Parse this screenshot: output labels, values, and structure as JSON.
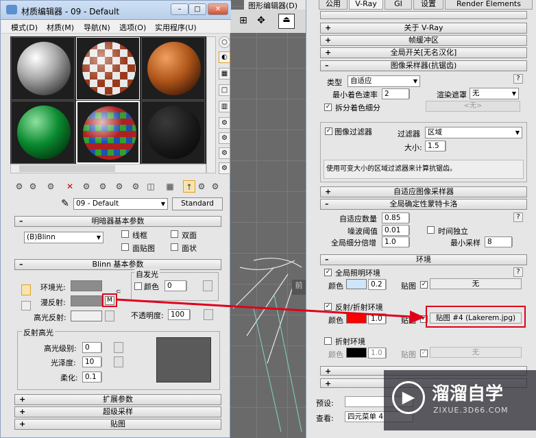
{
  "viewport_title": "图形编辑器(D)",
  "material_editor": {
    "title": "材质编辑器 - 09 - Default",
    "menu": [
      "模式(D)",
      "材质(M)",
      "导航(N)",
      "选项(O)",
      "实用程序(U)"
    ],
    "material_name": "09 - Default",
    "material_type": "Standard",
    "shader_rollout": "明暗器基本参数",
    "shader": "(B)Blinn",
    "shader_opts": [
      "线框",
      "双面",
      "面贴图",
      "面状"
    ],
    "blinn_rollout": "Blinn 基本参数",
    "self_illum": "自发光",
    "color_label": "颜色",
    "color_value": "0",
    "ambient": "环境光:",
    "diffuse": "漫反射:",
    "specular": "高光反射:",
    "diffuse_map_btn": "M",
    "opacity_label": "不透明度:",
    "opacity_value": "100",
    "spec_group": "反射高光",
    "spec_level_label": "高光级别:",
    "spec_level": "0",
    "gloss_label": "光泽度:",
    "gloss": "10",
    "soften_label": "柔化:",
    "soften": "0.1",
    "rollouts_bottom": [
      "扩展参数",
      "超级采样",
      "贴图"
    ]
  },
  "render_setup": {
    "tabs": [
      "公用",
      "V-Ray",
      "GI",
      "设置",
      "Render Elements"
    ],
    "rollouts": [
      "关于 V-Ray",
      "帧缓冲区",
      "全局开关[无名汉化]",
      "图像采样器(抗锯齿)"
    ],
    "type_label": "类型",
    "type_value": "自适应",
    "min_shading_label": "最小着色速率",
    "min_shading": "2",
    "render_mask_label": "渲染遮罩",
    "render_mask": "无",
    "none_btn": "<无>",
    "divide_shading": "拆分着色细分",
    "image_filter": "图像过滤器",
    "filter_label": "过滤器",
    "filter_value": "区域",
    "size_label": "大小:",
    "size_value": "1.5",
    "filter_desc": "使用可变大小的区域过滤器来计算抗锯齿。",
    "adaptive_rollout": "自适应图像采样器",
    "dmc_rollout": "全局确定性蒙特卡洛",
    "adaptive_amount_label": "自适应数量",
    "adaptive_amount": "0.85",
    "noise_label": "噪波阈值",
    "noise": "0.01",
    "time_indep": "时间独立",
    "subdiv_mult_label": "全局细分倍增",
    "subdiv_mult": "1.0",
    "min_samples_label": "最小采样",
    "min_samples": "8",
    "env_rollout": "环境",
    "gi_env": "全局照明环境",
    "color": "颜色",
    "gi_mult": "0.2",
    "map_label": "贴图",
    "none": "无",
    "refl_env": "反射/折射环境",
    "refl_mult": "1.0",
    "refl_map": "贴图 #4 (Lakerem.jpg)",
    "refr_env": "折射环境",
    "refr_mult": "1.0",
    "preset_label": "预设:",
    "view_label": "查看:",
    "view_value": "四元菜单 4",
    "help": "?"
  },
  "watermark": {
    "brand": "溜溜自学",
    "url": "ZIXUE.3D66.COM"
  }
}
